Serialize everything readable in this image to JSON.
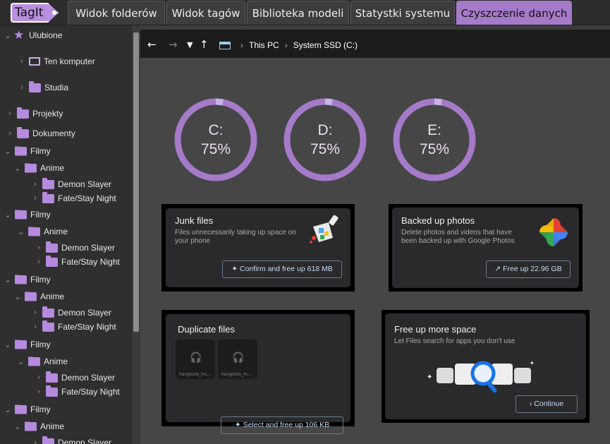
{
  "app": {
    "logo_text": "TagIt"
  },
  "tabs": [
    {
      "label": "Widok folderów"
    },
    {
      "label": "Widok tagów"
    },
    {
      "label": "Biblioteka modeli"
    },
    {
      "label": "Statystki systemu"
    },
    {
      "label": "Czyszczenie danych",
      "active": true
    }
  ],
  "sidebar": {
    "favorites": "Ulubione",
    "this_pc": "Ten komputer",
    "studio": "Studia",
    "projects": "Projekty",
    "documents": "Dokumenty",
    "groups": [
      {
        "folder": "Filmy",
        "sub": "Anime",
        "items": [
          "Demon Slayer",
          "Fate/Stay Night"
        ]
      },
      {
        "folder": "Filmy",
        "sub": "Anime",
        "items": [
          "Demon Slayer",
          "Fate/Stay Night"
        ]
      },
      {
        "folder": "Filmy",
        "sub": "Anime",
        "items": [
          "Demon Slayer",
          "Fate/Stay Night"
        ]
      },
      {
        "folder": "Filmy",
        "sub": "Anime",
        "items": [
          "Demon Slayer",
          "Fate/Stay Night"
        ]
      },
      {
        "folder": "Filmy",
        "sub": "Anime",
        "items": [
          "Demon Slayer"
        ]
      }
    ]
  },
  "address": {
    "crumbs": [
      "This PC",
      "System SSD (C:)"
    ]
  },
  "drives": [
    {
      "letter": "C:",
      "percent_label": "75%",
      "usage": 0.75
    },
    {
      "letter": "D:",
      "percent_label": "75%",
      "usage": 0.75
    },
    {
      "letter": "E:",
      "percent_label": "75%",
      "usage": 0.75
    }
  ],
  "cards": {
    "junk": {
      "title": "Junk files",
      "desc1": "Files unnecessarily taking up space on",
      "desc2": "your phone",
      "button": "Confirm and free up 618 MB"
    },
    "photos": {
      "title": "Backed up photos",
      "desc1": "Delete photos and videos that have",
      "desc2": "been backed up with Google Photos",
      "button": "Free up 22.96 GB"
    },
    "duplicates": {
      "title": "Duplicate files",
      "thumb1": "hangouts_inc...",
      "thumb2": "hangouts_m...",
      "button": "Select and free up 106 KB"
    },
    "space": {
      "title": "Free up more space",
      "desc1": "Let Files search for apps you don't use",
      "button": "Continue"
    }
  },
  "colors": {
    "accent": "#a57ac9",
    "folder": "#b58adf"
  }
}
